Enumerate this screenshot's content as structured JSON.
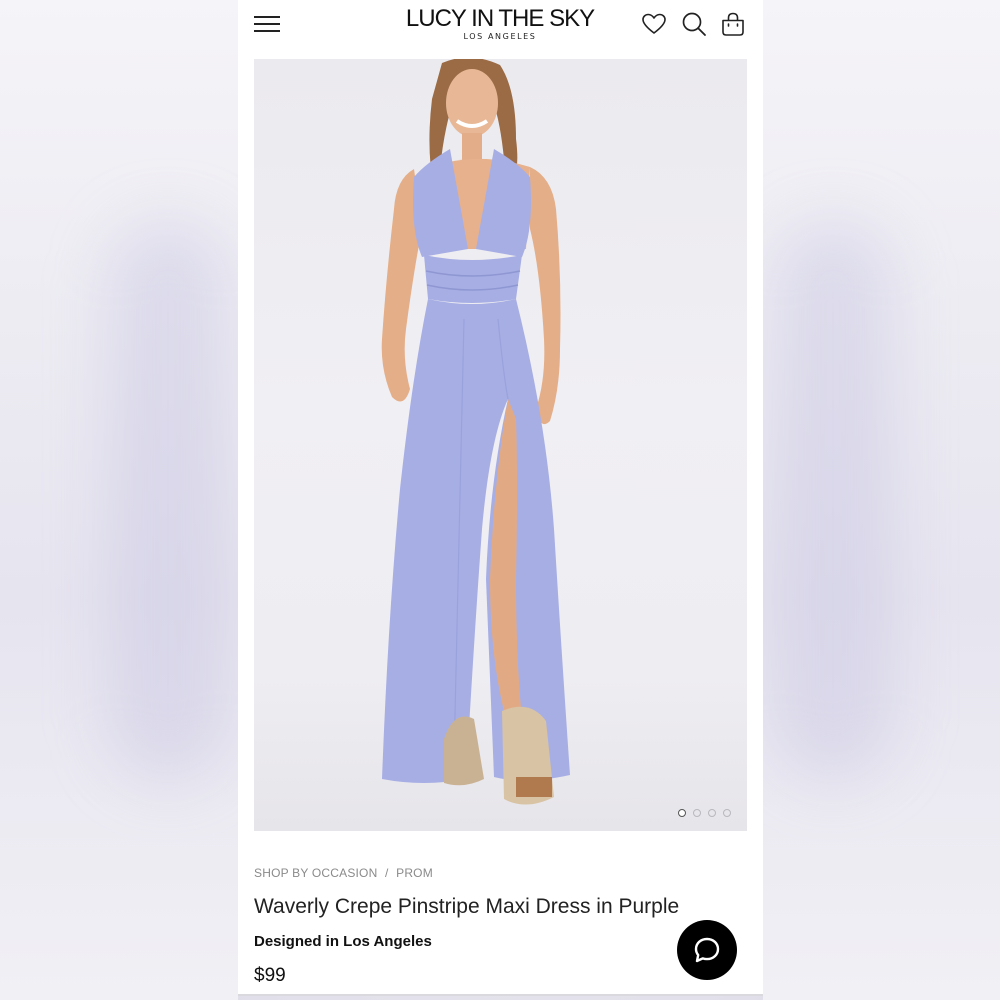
{
  "header": {
    "logo_main": "LUCY IN THE SKY",
    "logo_sub": "LOS ANGELES",
    "icons": [
      "hamburger-menu-icon",
      "heart-icon",
      "search-icon",
      "bag-icon"
    ]
  },
  "product": {
    "image_alt": "Model wearing a purple halter maxi dress with a thigh-high slit and platform heels",
    "dress_color": "#a7aee4",
    "carousel": {
      "total_images": 4,
      "active_index": 0
    },
    "breadcrumb": [
      "SHOP BY OCCASION",
      "PROM"
    ],
    "breadcrumb_separator": "/",
    "title": "Waverly Crepe Pinstripe Maxi Dress in Purple",
    "designed_in": "Designed in Los Angeles",
    "price": "$99"
  },
  "chat": {
    "icon": "chat-bubble-icon",
    "background": "#000000"
  }
}
